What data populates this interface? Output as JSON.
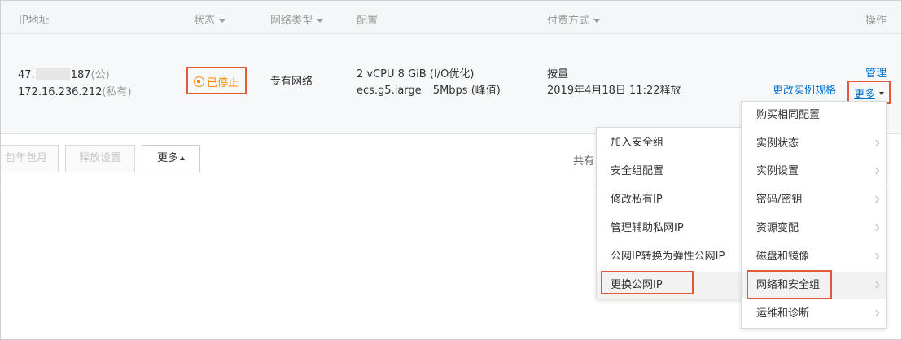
{
  "table": {
    "headers": {
      "ip": "IP地址",
      "status": "状态",
      "network_type": "网络类型",
      "config": "配置",
      "billing": "付费方式",
      "actions": "操作"
    },
    "row": {
      "public_ip_prefix": "47.",
      "public_ip_suffix": "187",
      "public_tag": "(公)",
      "private_ip": "172.16.236.212",
      "private_tag": "(私有)",
      "status": "已停止",
      "network_type": "专有网络",
      "config_line1": "2 vCPU 8 GiB (I/O优化)",
      "config_instance_type": "ecs.g5.large",
      "config_bandwidth": "5Mbps (峰值)",
      "billing_type": "按量",
      "billing_release": "2019年4月18日 11:22释放",
      "manage_link": "管理",
      "change_spec_link": "更改实例规格",
      "more_link": "更多"
    }
  },
  "toolbar": {
    "subscription_btn": "包年包月",
    "release_btn": "释放设置",
    "more_btn": "更多",
    "total_text": "共有"
  },
  "more_menu": {
    "items": [
      {
        "label": "购买相同配置",
        "submenu": false
      },
      {
        "label": "实例状态",
        "submenu": true
      },
      {
        "label": "实例设置",
        "submenu": true
      },
      {
        "label": "密码/密钥",
        "submenu": true
      },
      {
        "label": "资源变配",
        "submenu": true
      },
      {
        "label": "磁盘和镜像",
        "submenu": true
      },
      {
        "label": "网络和安全组",
        "submenu": true,
        "highlighted": true
      },
      {
        "label": "运维和诊断",
        "submenu": true
      }
    ]
  },
  "network_submenu": {
    "items": [
      {
        "label": "加入安全组"
      },
      {
        "label": "安全组配置"
      },
      {
        "label": "修改私有IP"
      },
      {
        "label": "管理辅助私网IP"
      },
      {
        "label": "公网IP转换为弹性公网IP"
      },
      {
        "label": "更换公网IP",
        "highlighted": true
      }
    ]
  },
  "colors": {
    "highlight_border": "#e05a3a",
    "link": "#0070cc",
    "status_stopped": "#ff8a00"
  }
}
